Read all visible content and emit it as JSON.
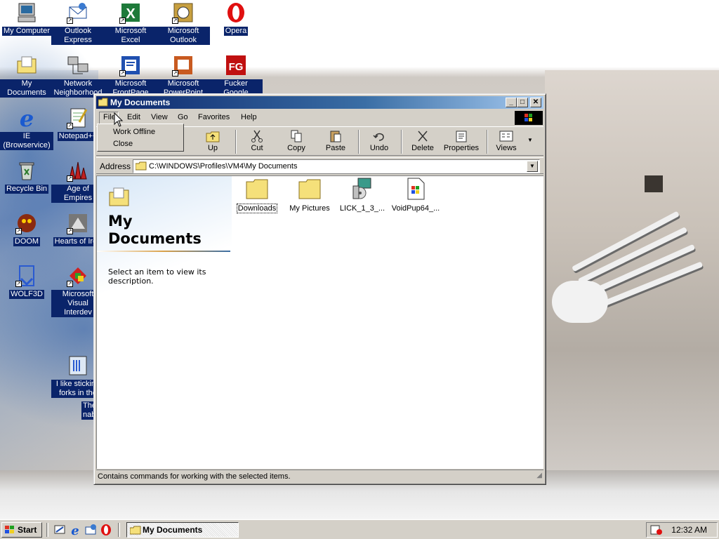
{
  "desktop": {
    "icons": [
      {
        "label": "My Computer",
        "icon": "my-computer-icon"
      },
      {
        "label": "Outlook Express",
        "icon": "outlook-express-icon"
      },
      {
        "label": "Microsoft Excel",
        "icon": "excel-icon"
      },
      {
        "label": "Microsoft Outlook",
        "icon": "outlook-icon"
      },
      {
        "label": "Opera",
        "icon": "opera-icon"
      },
      {
        "label": "My Documents",
        "icon": "my-documents-icon"
      },
      {
        "label": "Network Neighborhood",
        "icon": "network-neighborhood-icon"
      },
      {
        "label": "Microsoft FrontPage",
        "icon": "frontpage-icon"
      },
      {
        "label": "Microsoft PowerPoint",
        "icon": "powerpoint-icon"
      },
      {
        "label": "Fucker Google Antivirus 2019",
        "icon": "antivirus-icon"
      },
      {
        "label": "IE (Browservice)",
        "icon": "internet-explorer-icon"
      },
      {
        "label": "Notepad++",
        "icon": "notepad-icon"
      },
      {
        "label": "Recycle Bin",
        "icon": "recycle-bin-icon"
      },
      {
        "label": "Age of Empires",
        "icon": "age-of-empires-icon"
      },
      {
        "label": "DOOM",
        "icon": "doom-icon"
      },
      {
        "label": "Hearts of Iron",
        "icon": "hearts-of-iron-icon"
      },
      {
        "label": "WOLF3D",
        "icon": "wolf3d-icon"
      },
      {
        "label": "Microsoft Visual Interdev",
        "icon": "visual-interdev-icon"
      },
      {
        "label": "I like sticking forks in the",
        "icon": "forks-image-icon"
      },
      {
        "label": "The nab",
        "icon": "text-file-icon"
      }
    ]
  },
  "window": {
    "title": "My Documents",
    "menu": {
      "file": "File",
      "edit": "Edit",
      "view": "View",
      "go": "Go",
      "favorites": "Favorites",
      "help": "Help"
    },
    "file_menu": {
      "work_offline": "Work Offline",
      "close": "Close"
    },
    "toolbar": {
      "up": "Up",
      "cut": "Cut",
      "copy": "Copy",
      "paste": "Paste",
      "undo": "Undo",
      "delete": "Delete",
      "properties": "Properties",
      "views": "Views"
    },
    "address": {
      "label": "Address",
      "value": "C:\\WINDOWS\\Profiles\\VM4\\My Documents"
    },
    "left_pane": {
      "title": "My Documents",
      "description": "Select an item to view its description."
    },
    "files": [
      {
        "name": "Downloads",
        "icon": "folder-icon",
        "selected": true
      },
      {
        "name": "My Pictures",
        "icon": "folder-icon",
        "selected": false
      },
      {
        "name": "LICK_1_3_...",
        "icon": "installer-icon",
        "selected": false
      },
      {
        "name": "VoidPup64_...",
        "icon": "windows-file-icon",
        "selected": false
      }
    ],
    "status": "Contains commands for working with the selected items."
  },
  "taskbar": {
    "start": "Start",
    "task_button": "My Documents",
    "clock": "12:32 AM"
  },
  "colors": {
    "title_start": "#0a246a",
    "title_end": "#a6caf0",
    "face": "#d4d0c8",
    "selection": "#0a246a"
  }
}
